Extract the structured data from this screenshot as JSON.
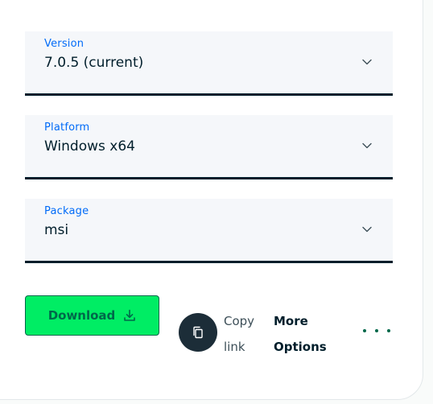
{
  "fields": [
    {
      "label": "Version",
      "value": "7.0.5 (current)"
    },
    {
      "label": "Platform",
      "value": "Windows x64"
    },
    {
      "label": "Package",
      "value": "msi"
    }
  ],
  "actions": {
    "download_label": "Download",
    "copy_label": "Copy link",
    "more_label": "More Options"
  },
  "icons": {
    "select_toggle": "chevron-down-icon",
    "download": "download-icon",
    "copy": "copy-icon",
    "more": "ellipsis-icon"
  },
  "colors": {
    "accent_green": "#00ed64",
    "dark_green": "#00684a",
    "label_blue": "#016bf8",
    "ink": "#001e2b"
  }
}
